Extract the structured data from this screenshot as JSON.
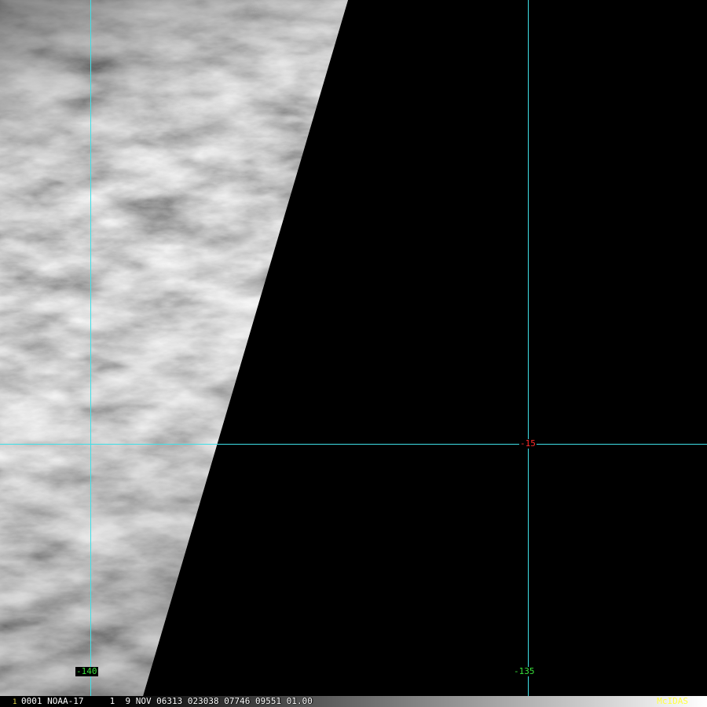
{
  "frame": {
    "number": "1",
    "status_line": "0001 NOAA-17     1  9 NOV 06313 023038 07746 09551 01.00",
    "brand": "McIDAS"
  },
  "grid": {
    "longitude_labels": [
      "-140",
      "-135"
    ],
    "latitude_labels": [
      "-15"
    ]
  },
  "colors": {
    "grid": "#3fe0e8",
    "longitude_label": "#39e03a",
    "latitude_label": "#ff2a2a",
    "frame_number": "#f0e050",
    "brand": "#ffff40",
    "no_data": "#000000"
  }
}
